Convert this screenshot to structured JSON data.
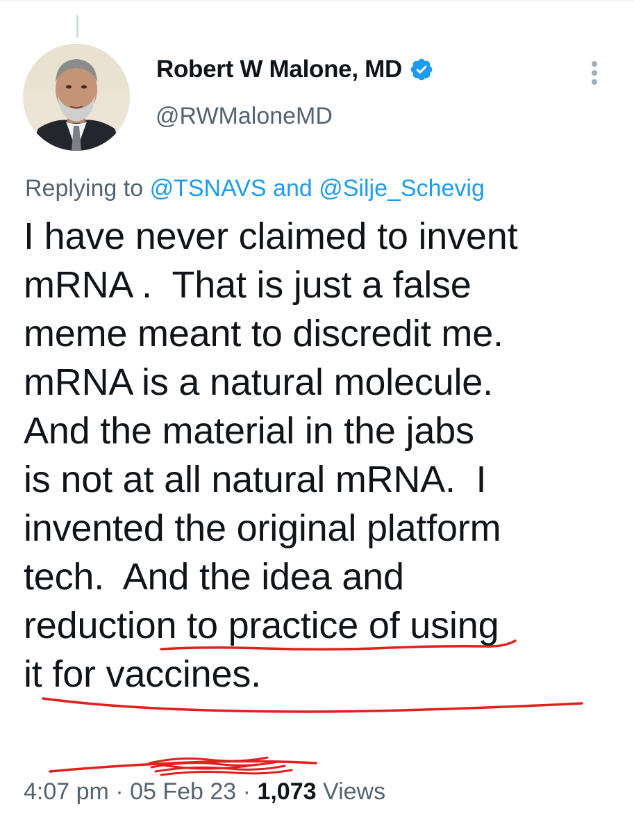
{
  "tweet": {
    "author": {
      "display_name": "Robert W Malone, MD",
      "handle": "@RWMaloneMD",
      "verified_icon": "verified-badge-icon",
      "avatar_icon": "profile-photo"
    },
    "more_icon": "more-options-icon",
    "reply_context": {
      "prefix": "Replying to",
      "mention_1": "@TSNAVS",
      "conjunction": "and",
      "mention_2": "@Silje_Schevig"
    },
    "text_lines": [
      "I have never claimed to invent",
      "mRNA .  That is just a false",
      "meme meant to discredit me.",
      "mRNA is a natural molecule.",
      "And the material in the jabs",
      "is not at all natural mRNA.  I",
      "invented the original platform",
      "tech.  And the idea and",
      "reduction to practice of using",
      "it for vaccines."
    ],
    "meta": {
      "time": "4:07 pm",
      "separator": "·",
      "date": "05 Feb 23",
      "views_count": "1,073",
      "views_label": "Views"
    }
  },
  "colors": {
    "primary_text": "#0f1419",
    "secondary_text": "#536471",
    "link_blue": "#1d9bf0",
    "annotation_red": "#e0201c"
  }
}
